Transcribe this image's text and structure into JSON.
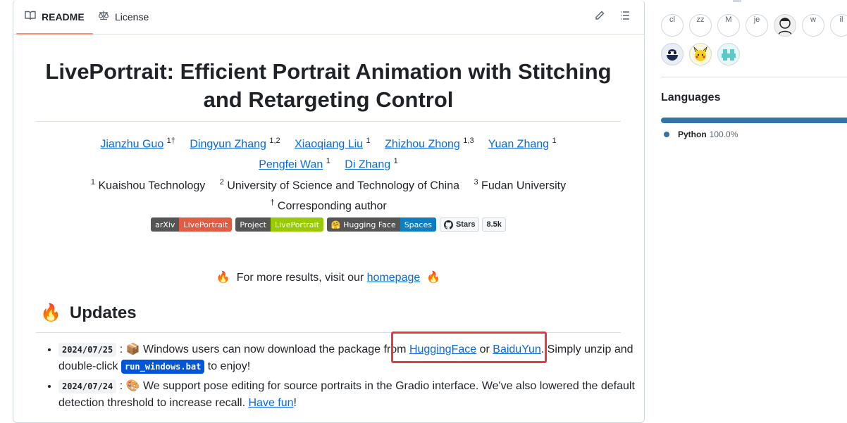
{
  "tabs": [
    {
      "label": "README",
      "icon": "book-icon"
    },
    {
      "label": "License",
      "icon": "scale-icon"
    }
  ],
  "readme": {
    "title": "LivePortrait: Efficient Portrait Animation with Stitching and Retargeting Control",
    "authors": [
      {
        "name": "Jianzhu Guo",
        "sup": "1†"
      },
      {
        "name": "Dingyun Zhang",
        "sup": "1,2"
      },
      {
        "name": "Xiaoqiang Liu",
        "sup": "1"
      },
      {
        "name": "Zhizhou Zhong",
        "sup": "1,3"
      },
      {
        "name": "Yuan Zhang",
        "sup": "1"
      },
      {
        "name": "Pengfei Wan",
        "sup": "1"
      },
      {
        "name": "Di Zhang",
        "sup": "1"
      }
    ],
    "affiliations": [
      {
        "sup": "1",
        "name": "Kuaishou Technology"
      },
      {
        "sup": "2",
        "name": "University of Science and Technology of China"
      },
      {
        "sup": "3",
        "name": "Fudan University"
      }
    ],
    "corresponding": {
      "sup": "†",
      "text": "Corresponding author"
    },
    "badges": [
      {
        "left": "arXiv",
        "right": "LivePortrait",
        "left_color": "#555555",
        "right_color": "#e05d44"
      },
      {
        "left": "Project",
        "right": "LivePortrait",
        "left_color": "#555555",
        "right_color": "#97ca00"
      },
      {
        "left": "🤗 Hugging Face",
        "right": "Spaces",
        "left_color": "#555555",
        "right_color": "#0f7ec1"
      }
    ],
    "github_badge": {
      "label": "Stars",
      "count": "8.5k"
    },
    "more_results": {
      "prefix": "For more results, visit our",
      "link": "homepage"
    },
    "updates_heading": "Updates",
    "updates": [
      {
        "date": "2024/07/25",
        "emoji": "📦",
        "text1": "Windows users can now download the package from",
        "link1": "HuggingFace",
        "mid": "or",
        "link2": "BaiduYun",
        "text2": ". Simply unzip and double-click",
        "code": "run_windows.bat",
        "text3": "to enjoy!"
      },
      {
        "date": "2024/07/24",
        "emoji": "🎨",
        "text1": "We support pose editing for source portraits in the Gradio interface. We've also lowered the default detection threshold to increase recall.",
        "link1": "Have fun",
        "text2": "!"
      }
    ]
  },
  "sidebar": {
    "contributors": [
      "cl",
      "zz",
      "M",
      "je",
      "",
      "w",
      "il",
      "",
      "",
      ""
    ],
    "languages_heading": "Languages",
    "languages": [
      {
        "name": "Python",
        "percent": "100.0%",
        "color": "#3572a5"
      }
    ]
  }
}
